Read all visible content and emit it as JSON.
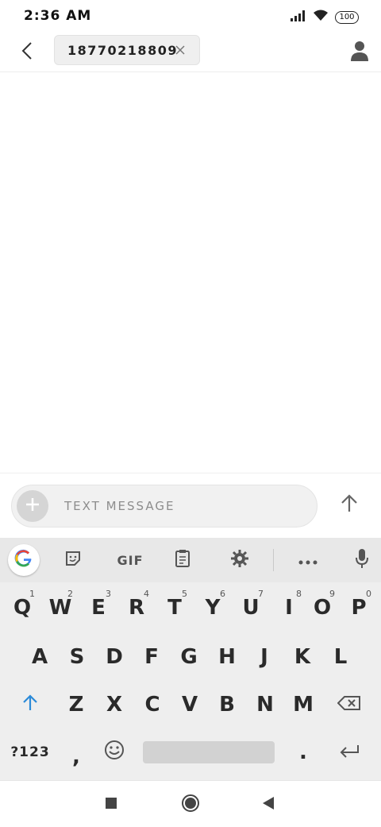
{
  "status_bar": {
    "time": "2:36 AM",
    "battery": "100",
    "icons": [
      "signal-icon",
      "wifi-icon",
      "battery-icon"
    ]
  },
  "header": {
    "recipient": "18770218809",
    "icons": [
      "back-arrow-icon",
      "close-icon",
      "person-icon"
    ]
  },
  "compose": {
    "placeholder": "TEXT MESSAGE",
    "value": "",
    "icons": [
      "plus-icon",
      "send-arrow-icon"
    ]
  },
  "keyboard": {
    "toolbar": {
      "gif_label": "GIF",
      "icons": [
        "google-g-icon",
        "sticker-icon",
        "clipboard-icon",
        "gear-icon",
        "more-dots-icon",
        "mic-icon"
      ]
    },
    "rows": [
      [
        {
          "label": "Q",
          "hint": "1"
        },
        {
          "label": "W",
          "hint": "2"
        },
        {
          "label": "E",
          "hint": "3"
        },
        {
          "label": "R",
          "hint": "4"
        },
        {
          "label": "T",
          "hint": "5"
        },
        {
          "label": "Y",
          "hint": "6"
        },
        {
          "label": "U",
          "hint": "7"
        },
        {
          "label": "I",
          "hint": "8"
        },
        {
          "label": "O",
          "hint": "9"
        },
        {
          "label": "P",
          "hint": "0"
        }
      ],
      [
        {
          "label": "A"
        },
        {
          "label": "S"
        },
        {
          "label": "D"
        },
        {
          "label": "F"
        },
        {
          "label": "G"
        },
        {
          "label": "H"
        },
        {
          "label": "J"
        },
        {
          "label": "K"
        },
        {
          "label": "L"
        }
      ],
      [
        {
          "label": "Z"
        },
        {
          "label": "X"
        },
        {
          "label": "C"
        },
        {
          "label": "V"
        },
        {
          "label": "B"
        },
        {
          "label": "N"
        },
        {
          "label": "M"
        }
      ]
    ],
    "bottom": {
      "symbols_label": "?123",
      "comma": ",",
      "period": "."
    },
    "accent": "#2b8ad8"
  },
  "nav_bar": {
    "icons": [
      "recents-square-icon",
      "home-circle-icon",
      "back-triangle-icon"
    ]
  }
}
